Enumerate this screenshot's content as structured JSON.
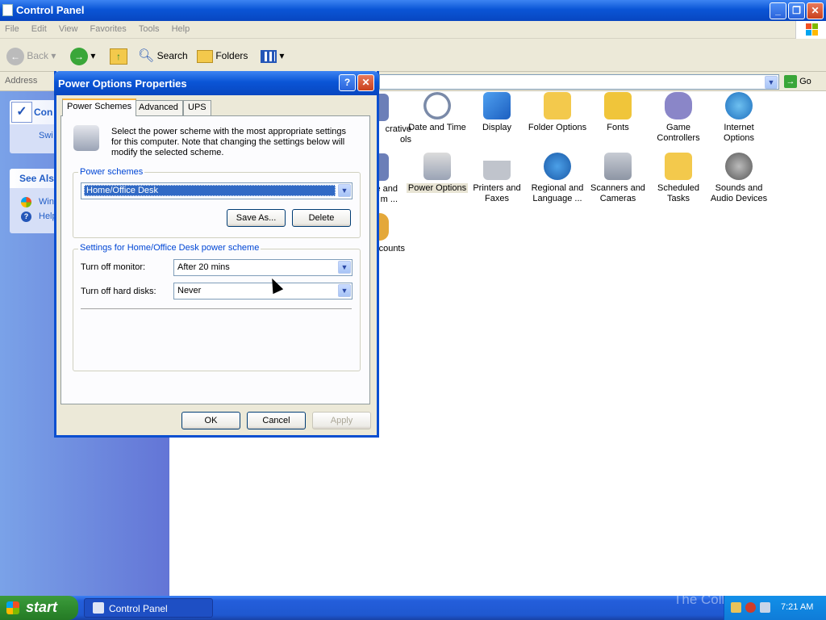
{
  "window": {
    "title": "Control Panel"
  },
  "menu": [
    "File",
    "Edit",
    "View",
    "Favorites",
    "Tools",
    "Help"
  ],
  "toolbar": {
    "back": "Back",
    "search": "Search",
    "folders": "Folders"
  },
  "address": {
    "label": "Address",
    "go": "Go"
  },
  "leftpane": {
    "panel_title": "Con",
    "switch_link": "Swi",
    "see_also": "See Als",
    "links": [
      "Win",
      "Help"
    ]
  },
  "icons": [
    {
      "label": "crative\nols"
    },
    {
      "label": "Date and Time"
    },
    {
      "label": "Display"
    },
    {
      "label": "Folder Options"
    },
    {
      "label": "Fonts"
    },
    {
      "label": "Game\nControllers"
    },
    {
      "label": "Internet\nOptions"
    },
    {
      "label": "e and\nm ..."
    },
    {
      "label": "Power Options"
    },
    {
      "label": "Printers and\nFaxes"
    },
    {
      "label": "Regional and\nLanguage ..."
    },
    {
      "label": "Scanners and\nCameras"
    },
    {
      "label": "Scheduled\nTasks"
    },
    {
      "label": "Sounds and\nAudio Devices"
    },
    {
      "label": "counts"
    }
  ],
  "dialog": {
    "title": "Power Options Properties",
    "tabs": [
      "Power Schemes",
      "Advanced",
      "UPS"
    ],
    "description": "Select the power scheme with the most appropriate settings for this computer. Note that changing the settings below will modify the selected scheme.",
    "schemes_group": "Power schemes",
    "scheme_value": "Home/Office Desk",
    "save_as": "Save As...",
    "delete": "Delete",
    "settings_group": "Settings for Home/Office Desk power scheme",
    "monitor_label": "Turn off monitor:",
    "monitor_value": "After 20 mins",
    "disks_label": "Turn off hard disks:",
    "disks_value": "Never",
    "ok": "OK",
    "cancel": "Cancel",
    "apply": "Apply"
  },
  "taskbar": {
    "start": "start",
    "task": "Control Panel",
    "clock": "7:21 AM",
    "watermark": "The Collection Book"
  }
}
